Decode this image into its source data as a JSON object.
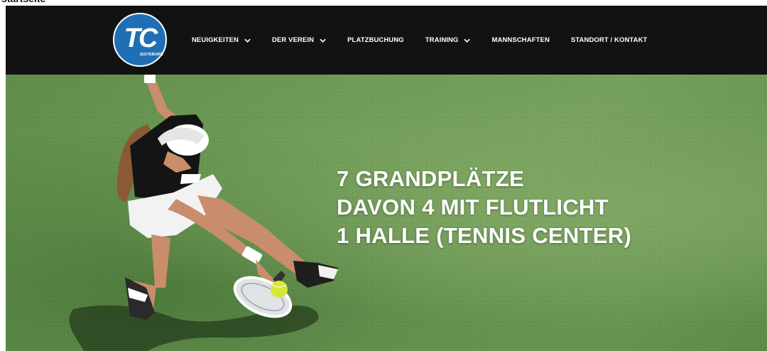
{
  "frame": {
    "clipped_text": "startseite"
  },
  "logo": {
    "initials": "TC",
    "subtitle": "JESTEBURG"
  },
  "nav": {
    "items": [
      {
        "label": "NEUIGKEITEN",
        "has_dropdown": true
      },
      {
        "label": "DER VEREIN",
        "has_dropdown": true
      },
      {
        "label": "PLATZBUCHUNG",
        "has_dropdown": false
      },
      {
        "label": "TRAINING",
        "has_dropdown": true
      },
      {
        "label": "MANNSCHAFTEN",
        "has_dropdown": false
      },
      {
        "label": "STANDORT / KONTAKT",
        "has_dropdown": false
      }
    ]
  },
  "hero": {
    "lines": [
      "7 GRANDPLÄTZE",
      "DAVON 4 MIT FLUTLICHT",
      "1 HALLE (TENNIS CENTER)"
    ]
  },
  "colors": {
    "navbar": "#121212",
    "logo_blue": "#1e6fb5",
    "grass": "#6f9b56",
    "ball": "#d6e93a",
    "text": "#ffffff"
  }
}
